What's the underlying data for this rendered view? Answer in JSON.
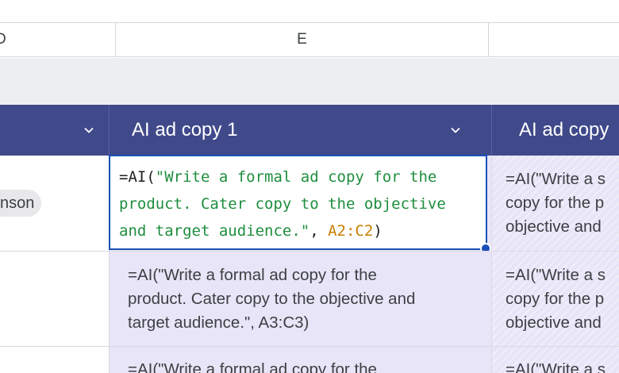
{
  "columns": {
    "d_label": "D",
    "e_label": "E"
  },
  "table": {
    "headers": {
      "col1_title": "AI ad copy 1",
      "col2_title": "AI ad copy"
    },
    "rows": [
      {
        "owner_chip": "nson",
        "editor": {
          "prefix": "=AI(",
          "string_line1": "\"Write a formal ad copy for the",
          "string_line2": "product. Cater copy to the objective",
          "string_line3": "and target audience.\"",
          "separator": ", ",
          "range_ref": "A2:C2",
          "suffix": ")"
        },
        "next_col_lines": [
          "=AI(\"Write a s",
          "copy for the p",
          "objective and"
        ]
      },
      {
        "formula_lines": [
          "=AI(\"Write a formal ad copy for the",
          "product. Cater copy to the objective and",
          "target audience.\", A3:C3)"
        ],
        "next_col_lines": [
          "=AI(\"Write a s",
          "copy for the p",
          "objective and"
        ]
      },
      {
        "formula_lines": [
          "=AI(\"Write a formal ad copy for the"
        ],
        "next_col_lines": [
          "=AI(\"Write a s"
        ]
      }
    ]
  }
}
